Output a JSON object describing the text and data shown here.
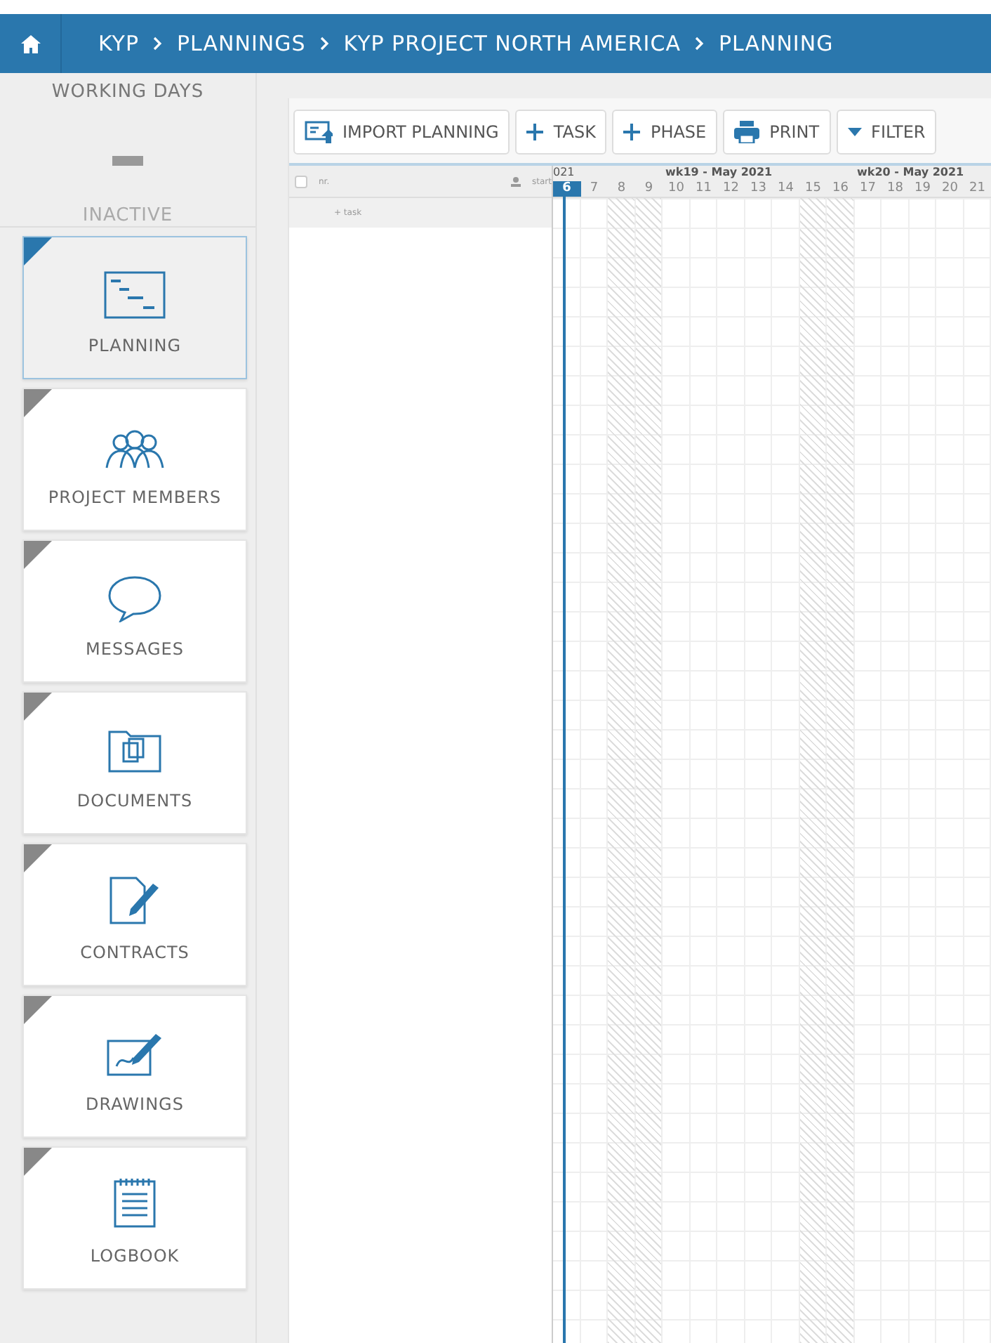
{
  "breadcrumb": [
    "KYP",
    "PLANNINGS",
    "KYP PROJECT NORTH AMERICA",
    "PLANNING"
  ],
  "working_days": {
    "title": "WORKING DAYS",
    "status": "INACTIVE"
  },
  "nav_items": [
    {
      "label": "PLANNING",
      "kind": "planning",
      "selected": true
    },
    {
      "label": "PROJECT MEMBERS",
      "kind": "members",
      "selected": false
    },
    {
      "label": "MESSAGES",
      "kind": "messages",
      "selected": false
    },
    {
      "label": "DOCUMENTS",
      "kind": "documents",
      "selected": false
    },
    {
      "label": "CONTRACTS",
      "kind": "contracts",
      "selected": false
    },
    {
      "label": "DRAWINGS",
      "kind": "drawings",
      "selected": false
    },
    {
      "label": "LOGBOOK",
      "kind": "logbook",
      "selected": false
    }
  ],
  "toolbar": [
    {
      "label": "IMPORT PLANNING",
      "kind": "import"
    },
    {
      "label": "TASK",
      "kind": "add"
    },
    {
      "label": "PHASE",
      "kind": "add"
    },
    {
      "label": "PRINT",
      "kind": "print"
    },
    {
      "label": "FILTER",
      "kind": "filter"
    }
  ],
  "gantt": {
    "select_all": {
      "checked": false
    },
    "columns": [
      "nr.",
      "start"
    ],
    "add_task": "+ task",
    "weeks": [
      {
        "label": "021",
        "days": [
          {
            "label": "6",
            "weekend": false,
            "selected": true
          },
          {
            "label": "7",
            "weekend": false,
            "selected": false
          },
          {
            "label": "8",
            "weekend": true,
            "selected": false
          },
          {
            "label": "9",
            "weekend": true,
            "selected": false
          }
        ]
      },
      {
        "label": "wk19 - May 2021",
        "days": [
          {
            "label": "10",
            "weekend": false,
            "selected": false
          },
          {
            "label": "11",
            "weekend": false,
            "selected": false
          },
          {
            "label": "12",
            "weekend": false,
            "selected": false
          },
          {
            "label": "13",
            "weekend": false,
            "selected": false
          },
          {
            "label": "14",
            "weekend": false,
            "selected": false
          },
          {
            "label": "15",
            "weekend": true,
            "selected": false
          },
          {
            "label": "16",
            "weekend": true,
            "selected": false
          }
        ]
      },
      {
        "label": "wk20 - May 2021",
        "days": [
          {
            "label": "17",
            "weekend": false,
            "selected": false
          },
          {
            "label": "18",
            "weekend": false,
            "selected": false
          },
          {
            "label": "19",
            "weekend": false,
            "selected": false
          },
          {
            "label": "20",
            "weekend": false,
            "selected": false
          },
          {
            "label": "21",
            "weekend": false,
            "selected": false
          }
        ]
      }
    ]
  }
}
